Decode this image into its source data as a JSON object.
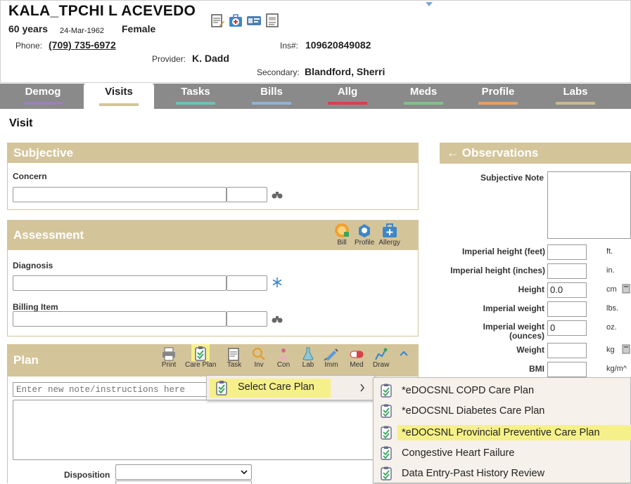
{
  "header": {
    "patient_name": "KALA_TPCHI L ACEVEDO",
    "age": "60 years",
    "dob": "24-Mar-1962",
    "sex": "Female",
    "phone_label": "Phone:",
    "phone": "(709) 735-6972",
    "provider_label": "Provider:",
    "provider": "K. Dadd",
    "ins_label": "Ins#:",
    "ins": "109620849082",
    "secondary_label": "Secondary:",
    "secondary": "Blandford, Sherri",
    "icons": [
      "notes-icon",
      "medical-kit-icon",
      "id-card-icon",
      "document-icon"
    ]
  },
  "tabs": [
    {
      "label": "Demog",
      "color": "#9b7fc0"
    },
    {
      "label": "Visits",
      "color": "#d4c49a",
      "active": true
    },
    {
      "label": "Tasks",
      "color": "#6fc1b4"
    },
    {
      "label": "Bills",
      "color": "#8fb2d8"
    },
    {
      "label": "Allg",
      "color": "#d9404a"
    },
    {
      "label": "Meds",
      "color": "#7cc487"
    },
    {
      "label": "Profile",
      "color": "#e0a16a"
    },
    {
      "label": "Labs",
      "color": "#c8b98d"
    }
  ],
  "page_title": "Visit",
  "subjective": {
    "title": "Subjective",
    "concern_label": "Concern"
  },
  "assessment": {
    "title": "Assessment",
    "diagnosis_label": "Diagnosis",
    "billing_label": "Billing Item",
    "actions": [
      "Bill",
      "Profile",
      "Allergy"
    ]
  },
  "plan": {
    "title": "Plan",
    "placeholder": "Enter new note/instructions here",
    "disposition_label": "Disposition",
    "tools": [
      "Print",
      "Care Plan",
      "Task",
      "Inv",
      "Con",
      "Lab",
      "Imm",
      "Med",
      "Draw"
    ]
  },
  "observations": {
    "title": "Observations",
    "subjective_note_label": "Subjective Note",
    "rows": [
      {
        "label": "Imperial height (feet)",
        "value": "",
        "unit": "ft."
      },
      {
        "label": "Imperial height (inches)",
        "value": "",
        "unit": "in."
      },
      {
        "label": "Height",
        "value": "0.0",
        "unit": "cm"
      },
      {
        "label": "Imperial weight",
        "value": "",
        "unit": "lbs."
      },
      {
        "label": "Imperial weight (ounces)",
        "value": "0",
        "unit": "oz."
      },
      {
        "label": "Weight",
        "value": "",
        "unit": "kg"
      },
      {
        "label": "BMI",
        "value": "",
        "unit": "kg/m^"
      }
    ]
  },
  "menus": {
    "select_care_plan": "Select Care Plan",
    "care_plans": [
      "*eDOCSNL COPD Care Plan",
      "*eDOCSNL Diabetes Care Plan",
      "*eDOCSNL Provincial Preventive Care Plan",
      "Congestive Heart Failure",
      "Data Entry-Past History Review"
    ],
    "highlight_color": "#f6f08a"
  }
}
